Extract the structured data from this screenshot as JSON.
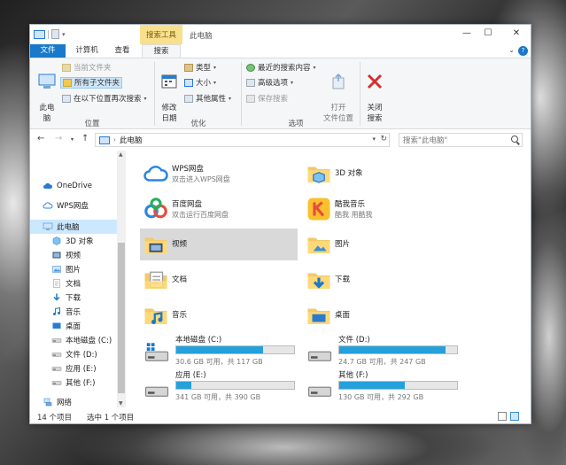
{
  "window": {
    "context_tab": "搜索工具",
    "title": "此电脑",
    "controls": {
      "minimize": "—",
      "maximize": "☐",
      "close": "✕"
    }
  },
  "tabs": [
    "文件",
    "计算机",
    "查看",
    "搜索"
  ],
  "ribbon": {
    "location_label": "位置",
    "thispc_btn": "此电\n脑",
    "current_folder": "当前文件夹",
    "all_subfolders": "所有子文件夹",
    "search_again": "在以下位置再次搜索",
    "refine_label": "优化",
    "date_modified": "修改\n日期",
    "kind": "类型",
    "size": "大小",
    "other_props": "其他属性",
    "options_label": "选项",
    "recent_searches": "最近的搜索内容",
    "advanced_options": "高级选项",
    "save_search": "保存搜索",
    "open_location": "打开\n文件位置",
    "close_search": "关闭\n搜索"
  },
  "address": {
    "path": "此电脑",
    "search_placeholder": "搜索\"此电脑\""
  },
  "nav": [
    {
      "label": "OneDrive",
      "icon": "cloud-icon"
    },
    {
      "label": "WPS网盘",
      "icon": "wps-cloud-icon"
    },
    {
      "label": "此电脑",
      "icon": "computer-icon",
      "selected": true
    },
    {
      "label": "3D 对象",
      "icon": "3d-objects-icon"
    },
    {
      "label": "视频",
      "icon": "video-icon"
    },
    {
      "label": "图片",
      "icon": "pictures-icon"
    },
    {
      "label": "文档",
      "icon": "documents-icon"
    },
    {
      "label": "下载",
      "icon": "download-icon"
    },
    {
      "label": "音乐",
      "icon": "music-icon"
    },
    {
      "label": "桌面",
      "icon": "desktop-icon"
    },
    {
      "label": "本地磁盘 (C:)",
      "icon": "drive-icon"
    },
    {
      "label": "文件 (D:)",
      "icon": "drive-icon"
    },
    {
      "label": "应用 (E:)",
      "icon": "drive-icon"
    },
    {
      "label": "其他 (F:)",
      "icon": "drive-icon"
    },
    {
      "label": "网络",
      "icon": "network-icon"
    }
  ],
  "folders": [
    {
      "name": "WPS网盘",
      "sub": "双击进入WPS网盘",
      "icon": "wps-cloud-icon"
    },
    {
      "name": "3D 对象",
      "sub": "",
      "icon": "folder-3d-icon"
    },
    {
      "name": "百度网盘",
      "sub": "双击运行百度网盘",
      "icon": "baidu-netdisk-icon"
    },
    {
      "name": "酷我音乐",
      "sub": "酷我 用酷我",
      "icon": "kuwo-music-icon"
    },
    {
      "name": "视频",
      "sub": "",
      "icon": "folder-video-icon",
      "selected": true
    },
    {
      "name": "图片",
      "sub": "",
      "icon": "folder-pictures-icon"
    },
    {
      "name": "文档",
      "sub": "",
      "icon": "folder-documents-icon"
    },
    {
      "name": "下载",
      "sub": "",
      "icon": "folder-download-icon"
    },
    {
      "name": "音乐",
      "sub": "",
      "icon": "folder-music-icon"
    },
    {
      "name": "桌面",
      "sub": "",
      "icon": "folder-desktop-icon"
    }
  ],
  "drives": [
    {
      "name": "本地磁盘 (C:)",
      "free": "30.6 GB 可用，共 117 GB",
      "used_fraction": 0.74
    },
    {
      "name": "文件 (D:)",
      "free": "24.7 GB 可用，共 247 GB",
      "used_fraction": 0.9
    },
    {
      "name": "应用 (E:)",
      "free": "341 GB 可用，共 390 GB",
      "used_fraction": 0.13
    },
    {
      "name": "其他 (F:)",
      "free": "130 GB 可用，共 292 GB",
      "used_fraction": 0.56
    }
  ],
  "status": {
    "count": "14 个项目",
    "selected": "选中 1 个项目"
  },
  "colors": {
    "accent": "#1979ca",
    "context_tab": "#f9e08f",
    "drive_bar": "#26a0da"
  }
}
